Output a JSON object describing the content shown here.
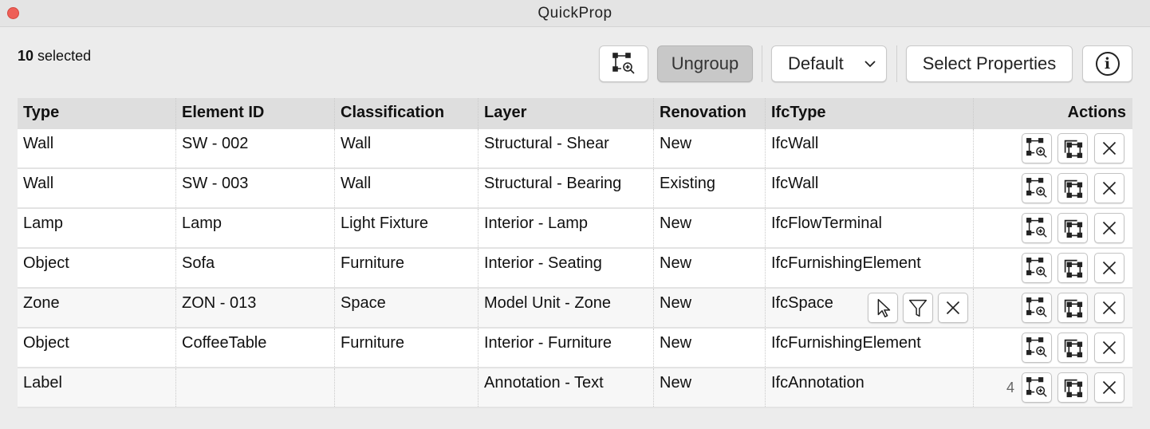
{
  "window": {
    "title": "QuickProp"
  },
  "selection": {
    "count": "10",
    "label": "selected"
  },
  "toolbar": {
    "zoom_icon": "zoom-to-selection-icon",
    "ungroup_label": "Ungroup",
    "preset_value": "Default",
    "select_properties_label": "Select Properties",
    "info_label": "i"
  },
  "table": {
    "columns": [
      "Type",
      "Element ID",
      "Classification",
      "Layer",
      "Renovation",
      "IfcType",
      "Actions"
    ],
    "rows": [
      {
        "type": "Wall",
        "id": "SW - 002",
        "classification": "Wall",
        "layer": "Structural - Shear",
        "renovation": "New",
        "ifc": "IfcWall"
      },
      {
        "type": "Wall",
        "id": "SW - 003",
        "classification": "Wall",
        "layer": "Structural - Bearing",
        "renovation": "Existing",
        "ifc": "IfcWall"
      },
      {
        "type": "Lamp",
        "id": "Lamp",
        "classification": "Light Fixture",
        "layer": "Interior - Lamp",
        "renovation": "New",
        "ifc": "IfcFlowTerminal"
      },
      {
        "type": "Object",
        "id": "Sofa",
        "classification": "Furniture",
        "layer": "Interior - Seating",
        "renovation": "New",
        "ifc": "IfcFurnishingElement"
      },
      {
        "type": "Zone",
        "id": "ZON - 013",
        "classification": "Space",
        "layer": "Model Unit - Zone",
        "renovation": "New",
        "ifc": "IfcSpace"
      },
      {
        "type": "Object",
        "id": "CoffeeTable",
        "classification": "Furniture",
        "layer": "Interior - Furniture",
        "renovation": "New",
        "ifc": "IfcFurnishingElement"
      },
      {
        "type": "Label",
        "id": "",
        "classification": "",
        "layer": "Annotation - Text",
        "renovation": "New",
        "ifc": "IfcAnnotation",
        "count": "4"
      }
    ]
  },
  "icons": {
    "zoom": "zoom-to-selection-icon",
    "select": "select-elements-icon",
    "remove": "remove-icon",
    "cursor": "cursor-icon",
    "filter": "filter-icon"
  }
}
